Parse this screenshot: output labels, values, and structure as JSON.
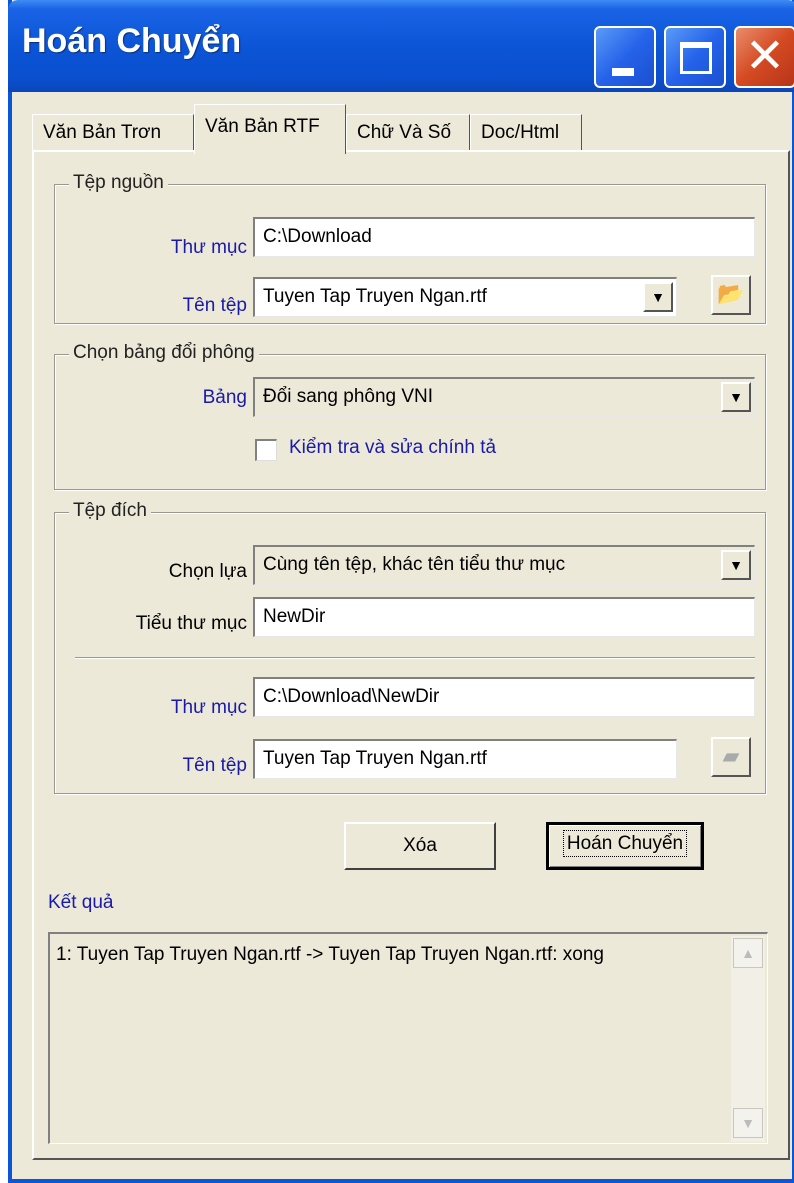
{
  "window": {
    "title": "Hoán Chuyển"
  },
  "tabs": [
    {
      "label": "Văn Bản Trơn"
    },
    {
      "label": "Văn Bản RTF"
    },
    {
      "label": "Chữ Và Số"
    },
    {
      "label": "Doc/Html"
    }
  ],
  "source": {
    "legend": "Tệp nguồn",
    "folder_label": "Thư mục",
    "folder_value": "C:\\Download",
    "file_label": "Tên tệp",
    "file_value": "Tuyen Tap Truyen Ngan.rtf"
  },
  "table": {
    "legend": "Chọn bảng đổi phông",
    "label": "Bảng",
    "value": "Đổi sang phông VNI",
    "spellcheck_label": "Kiểm tra và sửa chính tả",
    "spellcheck_checked": false
  },
  "dest": {
    "legend": "Tệp đích",
    "option_label": "Chọn lựa",
    "option_value": "Cùng tên tệp, khác tên tiểu thư mục",
    "subdir_label": "Tiểu thư mục",
    "subdir_value": "NewDir",
    "folder_label": "Thư mục",
    "folder_value": "C:\\Download\\NewDir",
    "file_label": "Tên tệp",
    "file_value": "Tuyen Tap Truyen Ngan.rtf"
  },
  "buttons": {
    "clear": "Xóa",
    "convert": "Hoán Chuyển"
  },
  "result": {
    "label": "Kết quả",
    "lines": [
      "1: Tuyen Tap Truyen Ngan.rtf -> Tuyen Tap Truyen Ngan.rtf: xong"
    ]
  },
  "icons": {
    "open_folder": "open-folder-icon",
    "browse_disabled": "folder-icon",
    "minimize": "minimize-icon",
    "maximize": "maximize-icon",
    "close": "close-icon",
    "dropdown": "chevron-down-icon",
    "scroll_up": "scroll-up-icon",
    "scroll_down": "scroll-down-icon"
  },
  "colors": {
    "titlebar": "#0b55d6",
    "label_blue": "#1a1aa8",
    "window_bg": "#ece9d8",
    "close_button": "#d44a22"
  }
}
